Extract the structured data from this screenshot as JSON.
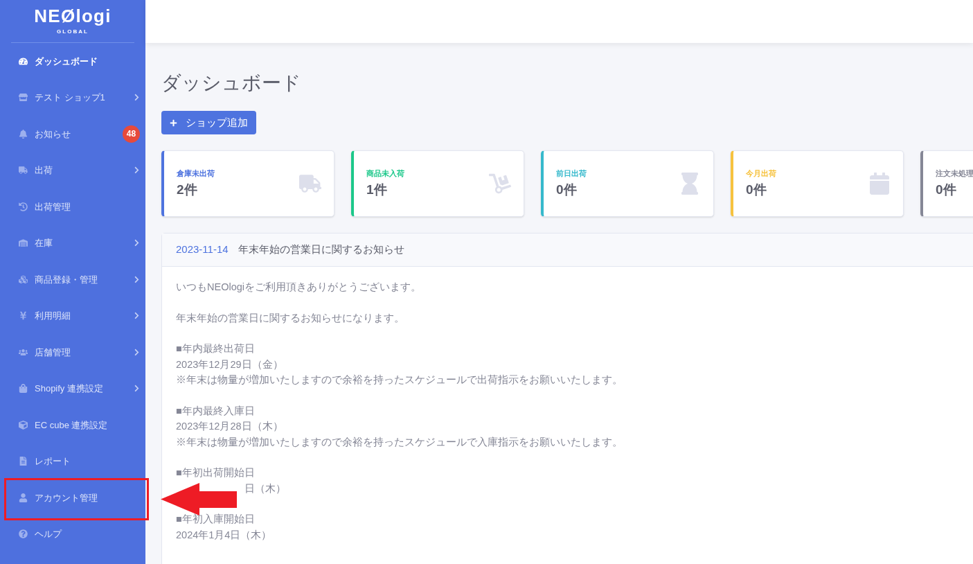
{
  "logo": {
    "name": "NEØlogi",
    "sub": "GLOBAL"
  },
  "sidebar": {
    "items": [
      {
        "label": "ダッシュボード",
        "selected": true,
        "submenu": false
      },
      {
        "label": "テスト ショップ1",
        "selected": false,
        "submenu": true
      },
      {
        "label": "お知らせ",
        "selected": false,
        "submenu": false,
        "badge": "48"
      },
      {
        "label": "出荷",
        "selected": false,
        "submenu": true
      },
      {
        "label": "出荷管理",
        "selected": false,
        "submenu": false
      },
      {
        "label": "在庫",
        "selected": false,
        "submenu": true
      },
      {
        "label": "商品登録・管理",
        "selected": false,
        "submenu": true
      },
      {
        "label": "利用明細",
        "selected": false,
        "submenu": true
      },
      {
        "label": "店舗管理",
        "selected": false,
        "submenu": true
      },
      {
        "label": "Shopify 連携設定",
        "selected": false,
        "submenu": true
      },
      {
        "label": "EC cube 連携設定",
        "selected": false,
        "submenu": false
      },
      {
        "label": "レポート",
        "selected": false,
        "submenu": false
      },
      {
        "label": "アカウント管理",
        "selected": false,
        "submenu": false
      },
      {
        "label": "ヘルプ",
        "selected": false,
        "submenu": false
      }
    ]
  },
  "page_title": "ダッシュボード",
  "add_button": "ショップ追加",
  "cards": [
    {
      "label": "倉庫未出荷",
      "value": "2件",
      "color": "#4e73df"
    },
    {
      "label": "商品未入荷",
      "value": "1件",
      "color": "#1cc88a"
    },
    {
      "label": "前日出荷",
      "value": "0件",
      "color": "#36b9cc"
    },
    {
      "label": "今月出荷",
      "value": "0件",
      "color": "#f6c23e"
    },
    {
      "label": "注文未処理",
      "value": "0件",
      "color": "#858796"
    }
  ],
  "notice": {
    "date": "2023-11-14",
    "title": "年末年始の営業日に関するお知らせ",
    "paragraphs": [
      {
        "lines": [
          {
            "kind": "full",
            "text": "いつもNEOlogiをご利用頂きありがとうございます。"
          }
        ]
      },
      {
        "lines": [
          {
            "kind": "full",
            "text": "年末年始の営業日に関するお知らせになります。"
          }
        ]
      },
      {
        "lines": [
          {
            "kind": "full",
            "text": "■年内最終出荷日"
          },
          {
            "kind": "full",
            "text": "2023年12月29日（金）"
          },
          {
            "kind": "full",
            "text": "※年末は物量が増加いたしますので余裕を持ったスケジュールで出荷指示をお願いいたします。"
          }
        ]
      },
      {
        "lines": [
          {
            "kind": "full",
            "text": "■年内最終入庫日"
          },
          {
            "kind": "full",
            "text": "2023年12月28日（木）"
          },
          {
            "kind": "full",
            "text": "※年末は物量が増加いたしますので余裕を持ったスケジュールで入庫指示をお願いいたします。"
          }
        ]
      },
      {
        "lines": [
          {
            "kind": "full",
            "text": "■年初出荷開始日"
          },
          {
            "kind": "covered",
            "text": "日（木）"
          }
        ]
      },
      {
        "lines": [
          {
            "kind": "full",
            "text": "■年初入庫開始日"
          },
          {
            "kind": "full",
            "text": "2024年1月4日（木）"
          }
        ]
      }
    ]
  }
}
